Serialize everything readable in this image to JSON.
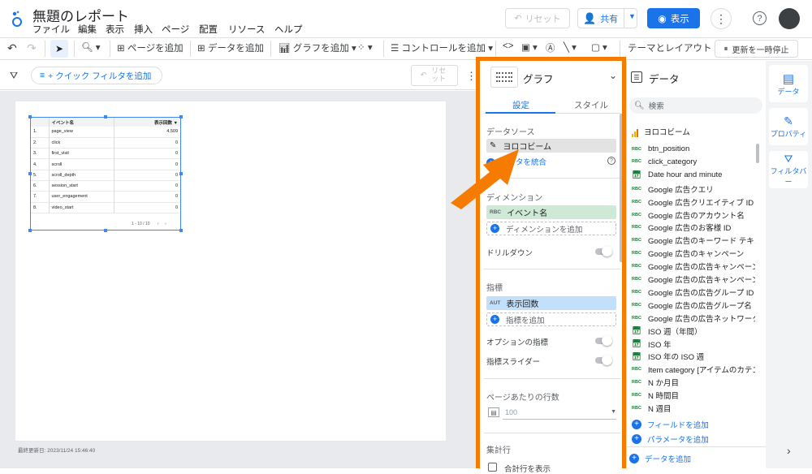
{
  "app": {
    "title": "無題のレポート",
    "menu": [
      "ファイル",
      "編集",
      "表示",
      "挿入",
      "ページ",
      "配置",
      "リソース",
      "ヘルプ"
    ]
  },
  "header": {
    "reset_label": "リセット",
    "share_label": "共有",
    "view_label": "表示"
  },
  "toolbar": {
    "add_page": "ページを追加",
    "add_data": "データを追加",
    "add_chart": "グラフを追加",
    "add_control": "コントロールを追加",
    "theme_layout": "テーマとレイアウト",
    "pause_update": "更新を一時停止"
  },
  "filterbar": {
    "quick_filter": "+ クイック フィルタを追加",
    "reset": "リセット"
  },
  "report_table": {
    "headers": [
      "イベント名",
      "表示回数 ▼"
    ],
    "rows": [
      {
        "num": "1.",
        "name": "page_view",
        "value": "4,509"
      },
      {
        "num": "2.",
        "name": "click",
        "value": "0"
      },
      {
        "num": "3.",
        "name": "first_visit",
        "value": "0"
      },
      {
        "num": "4.",
        "name": "scroll",
        "value": "0"
      },
      {
        "num": "5.",
        "name": "scroll_depth",
        "value": "0"
      },
      {
        "num": "6.",
        "name": "session_start",
        "value": "0"
      },
      {
        "num": "7.",
        "name": "user_engagement",
        "value": "0"
      },
      {
        "num": "8.",
        "name": "video_start",
        "value": "0"
      }
    ],
    "pagination": "1 - 10 / 10"
  },
  "last_updated": "最終更新日: 2023/11/24 15:46:40",
  "graph_panel": {
    "chart_type": "グラフ",
    "tabs": [
      "設定",
      "スタイル"
    ],
    "datasource_label": "データソース",
    "datasource_name": "ヨロコビーム",
    "blend_link": "データを統合",
    "dimension_label": "ディメンション",
    "dimension_chip_type": "RBC",
    "dimension_chip": "イベント名",
    "add_dimension": "ディメンションを追加",
    "drilldown": "ドリルダウン",
    "metric_label": "指標",
    "metric_chip_type": "AUT",
    "metric_chip": "表示回数",
    "add_metric": "指標を追加",
    "optional_metric": "オプションの指標",
    "metric_slider": "指標スライダー",
    "rows_per_page_label": "ページあたりの行数",
    "rows_per_page_value": "100",
    "summary_label": "集計行",
    "summary_show": "合計行を表示"
  },
  "data_panel": {
    "title": "データ",
    "search_placeholder": "検索",
    "source_name": "ヨロコビーム",
    "fields": [
      {
        "type": "RBC",
        "name": "btn_position"
      },
      {
        "type": "RBC",
        "name": "click_category"
      },
      {
        "type": "cal",
        "name": "Date hour and minute"
      },
      {
        "type": "RBC",
        "name": "Google 広告クエリ"
      },
      {
        "type": "RBC",
        "name": "Google 広告クリエイティブ ID"
      },
      {
        "type": "RBC",
        "name": "Google 広告のアカウント名"
      },
      {
        "type": "RBC",
        "name": "Google 広告のお客様 ID"
      },
      {
        "type": "RBC",
        "name": "Google 広告のキーワード テキスト"
      },
      {
        "type": "RBC",
        "name": "Google 広告のキャンペーン"
      },
      {
        "type": "RBC",
        "name": "Google 広告の広告キャンペーン ID"
      },
      {
        "type": "RBC",
        "name": "Google 広告の広告キャンペーン タ…"
      },
      {
        "type": "RBC",
        "name": "Google 広告の広告グループ ID"
      },
      {
        "type": "RBC",
        "name": "Google 広告の広告グループ名"
      },
      {
        "type": "RBC",
        "name": "Google 広告の広告ネットワーク タ…"
      },
      {
        "type": "cal",
        "name": "ISO 週（年間）"
      },
      {
        "type": "cal",
        "name": "ISO 年"
      },
      {
        "type": "cal",
        "name": "ISO 年の ISO 週"
      },
      {
        "type": "RBC",
        "name": "Item category [アイテムのカテゴリ]"
      },
      {
        "type": "RBC",
        "name": "N か月目"
      },
      {
        "type": "RBC",
        "name": "N 時間目"
      },
      {
        "type": "RBC",
        "name": "N 週目"
      }
    ],
    "add_field": "フィールドを追加",
    "add_parameter": "パラメータを追加",
    "add_data": "データを追加"
  },
  "right_rail": {
    "data": "データ",
    "properties": "プロパティ",
    "filter_bar": "フィルタバー"
  },
  "colors": {
    "orange": "#f57c00",
    "blue": "#1a73e8",
    "green_chip": "#ceead6",
    "blue_chip": "#c2e0fb"
  }
}
